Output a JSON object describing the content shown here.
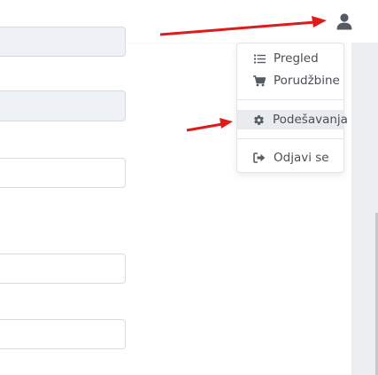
{
  "header": {
    "user_icon": "user-icon"
  },
  "form": {
    "fields": [
      {
        "value": ""
      },
      {
        "value": ""
      },
      {
        "value": ""
      },
      {
        "value": ""
      },
      {
        "value": ""
      }
    ]
  },
  "user_menu": {
    "items": [
      {
        "label": "Pregled",
        "icon": "list-icon"
      },
      {
        "label": "Porudžbine",
        "icon": "cart-icon"
      },
      {
        "label": "Podešavanja",
        "icon": "gear-icon"
      },
      {
        "label": "Odjavi se",
        "icon": "sign-out-icon"
      }
    ],
    "active_item": "Podešavanja"
  },
  "annotations": {
    "arrow_color": "#e01b1b"
  },
  "colors": {
    "icon": "#545b62",
    "menu_active_bg": "#e9ecef",
    "readonly_field_bg": "#eef1f5"
  }
}
